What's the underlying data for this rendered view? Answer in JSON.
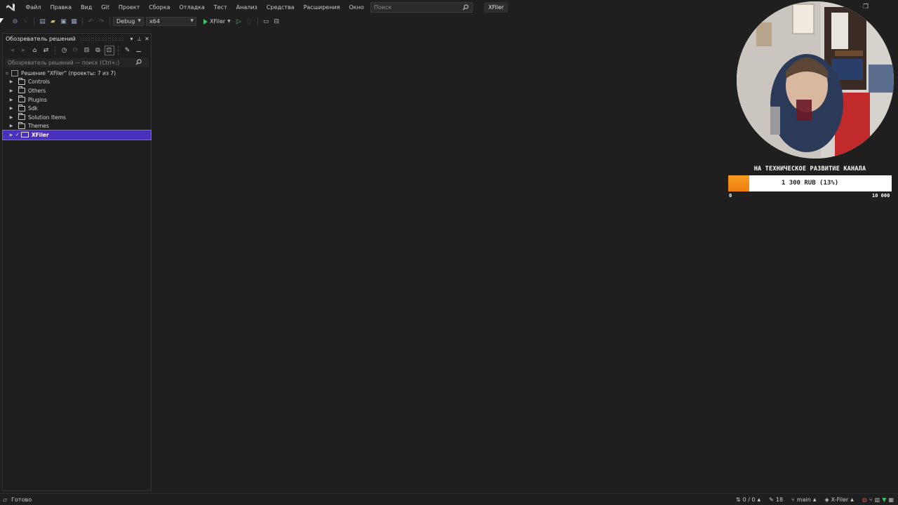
{
  "menubar": {
    "items": [
      "Файл",
      "Правка",
      "Вид",
      "Git",
      "Проект",
      "Сборка",
      "Отладка",
      "Тест",
      "Анализ",
      "Средства",
      "Расширения",
      "Окно",
      "Справка"
    ],
    "search_placeholder": "Поиск",
    "solution_name": "XFiler"
  },
  "toolbar": {
    "configuration": "Debug",
    "platform": "x64",
    "run_target": "XFiler"
  },
  "solution_explorer": {
    "title": "Обозреватель решений",
    "search_placeholder": "Обозреватель решений — поиск (Ctrl+;)",
    "root_label": "Решение \"XFiler\" (проекты: 7 из 7)",
    "folders": [
      "Controls",
      "Others",
      "Plugins",
      "Sdk",
      "Solution Items",
      "Themes"
    ],
    "selected_project": "XFiler"
  },
  "donation": {
    "title": "НА ТЕХНИЧЕСКОЕ РАЗВИТИЕ КАНАЛА",
    "amount_text": "1 300 RUB (13%)",
    "progress": 0.13,
    "min_label": "0",
    "max_label": "10 000",
    "fill_color": "#f28a14"
  },
  "statusbar": {
    "status": "Готово",
    "changes": "0 / 0",
    "edits": "18",
    "branch": "main",
    "repo": "X-Filer"
  },
  "colors": {
    "background": "#1f1f1f",
    "selection": "#4b2fbd"
  }
}
